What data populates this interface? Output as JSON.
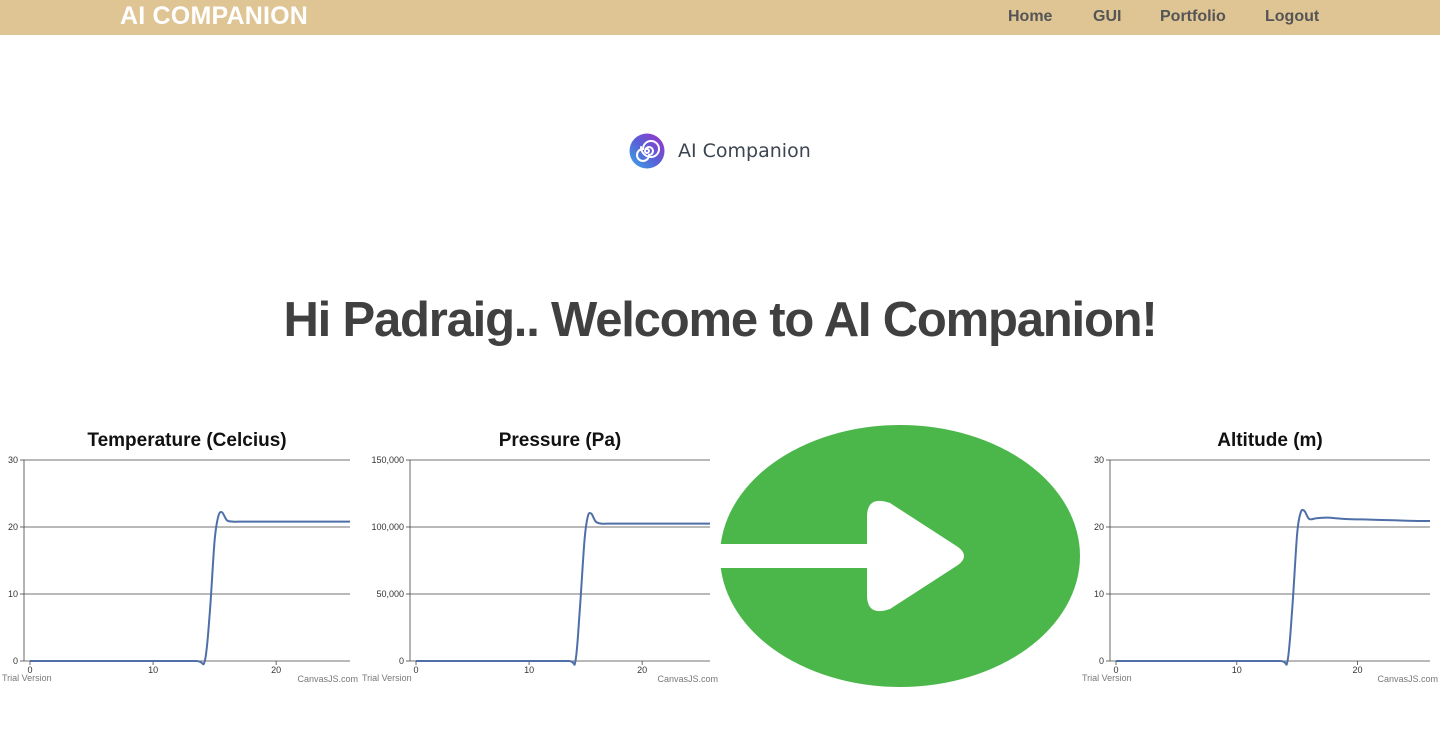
{
  "navbar": {
    "brand": "AI COMPANION",
    "links": [
      "Home",
      "GUI",
      "Portfolio",
      "Logout"
    ]
  },
  "logo": {
    "text": "AI Companion",
    "icon": "spiral-logo-icon"
  },
  "welcome": "Hi Padraig.. Welcome to AI Companion!",
  "arrow": {
    "icon": "arrow-right-circle-icon",
    "color": "#4bb74b"
  },
  "colors": {
    "navbar_bg": "#dfc494",
    "series_line": "#4f6fa8"
  },
  "chart_data": [
    {
      "type": "line",
      "title": "Temperature (Celcius)",
      "xlim": [
        0,
        26
      ],
      "ylim": [
        0,
        30
      ],
      "x_ticks": [
        0,
        10,
        20
      ],
      "y_ticks": [
        0,
        10,
        20,
        30
      ],
      "grid": true,
      "credit_left": "Trial Version",
      "credit_right": "CanvasJS.com",
      "series": [
        {
          "x": [
            0,
            10,
            13.5,
            14.2,
            14.6,
            15.0,
            15.3,
            15.6,
            16.0,
            16.5,
            17,
            19,
            22,
            26
          ],
          "y": [
            0,
            0,
            0,
            0,
            7,
            18,
            21.6,
            22.2,
            21,
            20.8,
            20.8,
            20.8,
            20.8,
            20.8
          ]
        }
      ]
    },
    {
      "type": "line",
      "title": "Pressure (Pa)",
      "xlim": [
        0,
        26
      ],
      "ylim": [
        0,
        150000
      ],
      "x_ticks": [
        0,
        10,
        20
      ],
      "y_ticks": [
        0,
        50000,
        100000,
        150000
      ],
      "y_tick_labels": [
        "0",
        "50,000",
        "100,000",
        "150,000"
      ],
      "grid": true,
      "credit_left": "Trial Version",
      "credit_right": "CanvasJS.com",
      "series": [
        {
          "x": [
            0,
            10,
            13.5,
            14.1,
            14.5,
            14.9,
            15.2,
            15.5,
            15.9,
            16.4,
            17,
            20,
            23,
            26
          ],
          "y": [
            0,
            0,
            0,
            0,
            40000,
            90000,
            108000,
            110000,
            104000,
            102500,
            102500,
            102500,
            102500,
            102500
          ]
        }
      ]
    },
    {
      "type": "line",
      "title": "Altitude (m)",
      "xlim": [
        0,
        26
      ],
      "ylim": [
        0,
        30
      ],
      "x_ticks": [
        0,
        10,
        20
      ],
      "y_ticks": [
        0,
        10,
        20,
        30
      ],
      "grid": true,
      "credit_left": "Trial Version",
      "credit_right": "CanvasJS.com",
      "series": [
        {
          "x": [
            0,
            10,
            13.6,
            14.2,
            14.6,
            15.0,
            15.3,
            15.6,
            16.0,
            16.6,
            17.5,
            19,
            21,
            23,
            25,
            26
          ],
          "y": [
            0,
            0,
            0,
            0,
            8,
            19,
            22.2,
            22.4,
            21.2,
            21.3,
            21.4,
            21.2,
            21.1,
            21.0,
            20.9,
            20.9
          ]
        }
      ]
    }
  ]
}
